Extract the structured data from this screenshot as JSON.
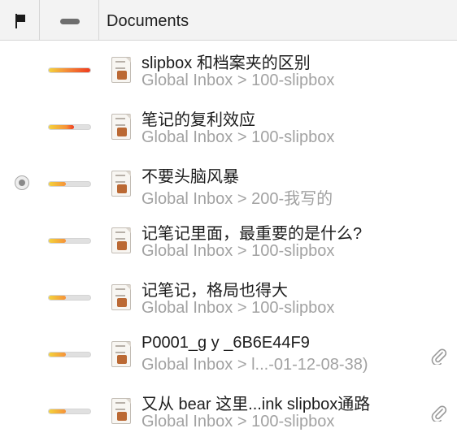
{
  "header": {
    "documents_label": "Documents"
  },
  "icons": {
    "flag_column": "flag-icon",
    "score_column": "dash-icon",
    "document": "document-icon",
    "attachment": "paperclip-icon"
  },
  "colors": {
    "bar_track": "#e0e0e0",
    "bar_red": "#ef3b1f",
    "bar_orange": "#f5913a",
    "bar_yellow": "#f4d33b"
  },
  "rows": [
    {
      "title": "slipbox 和档案夹的区别",
      "path": "Global Inbox > 100-slipbox",
      "score": 1.0,
      "selected": false,
      "attachment": false
    },
    {
      "title": "笔记的复利效应",
      "path": "Global Inbox > 100-slipbox",
      "score": 0.6,
      "selected": false,
      "attachment": false
    },
    {
      "title": "不要头脑风暴",
      "path": "Global Inbox > 200-我写的",
      "score": 0.42,
      "selected": true,
      "attachment": false
    },
    {
      "title": "记笔记里面，最重要的是什么?",
      "path": "Global Inbox > 100-slipbox",
      "score": 0.42,
      "selected": false,
      "attachment": false
    },
    {
      "title": "记笔记，格局也得大",
      "path": "Global Inbox > 100-slipbox",
      "score": 0.42,
      "selected": false,
      "attachment": false
    },
    {
      "title": "P0001_g y _6B6E44F9",
      "path": "Global Inbox > l...-01-12-08-38)",
      "score": 0.42,
      "selected": false,
      "attachment": true
    },
    {
      "title": "又从 bear 这里...ink slipbox通路",
      "path": "Global Inbox > 100-slipbox",
      "score": 0.42,
      "selected": false,
      "attachment": true
    }
  ]
}
